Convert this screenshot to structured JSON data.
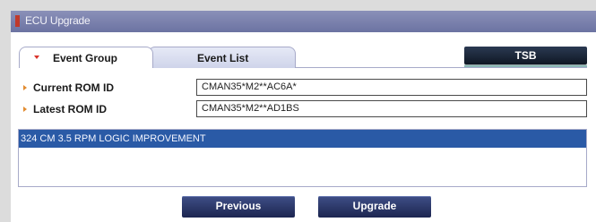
{
  "window": {
    "title": "ECU Upgrade"
  },
  "tabs": [
    {
      "label": "Event Group",
      "active": true
    },
    {
      "label": "Event List",
      "active": false
    }
  ],
  "toolbar": {
    "tsb_label": "TSB"
  },
  "fields": {
    "current_rom": {
      "label": "Current ROM ID",
      "value": "CMAN35*M2**AC6A*"
    },
    "latest_rom": {
      "label": "Latest ROM ID",
      "value": "CMAN35*M2**AD1BS"
    }
  },
  "list": {
    "items": [
      {
        "text": "324 CM 3.5 RPM LOGIC IMPROVEMENT",
        "selected": true
      }
    ]
  },
  "buttons": {
    "previous": "Previous",
    "upgrade": "Upgrade"
  },
  "colors": {
    "title_bar": "#7a81ad",
    "selection": "#2a5aa6",
    "tab_border": "#a7aac9"
  }
}
